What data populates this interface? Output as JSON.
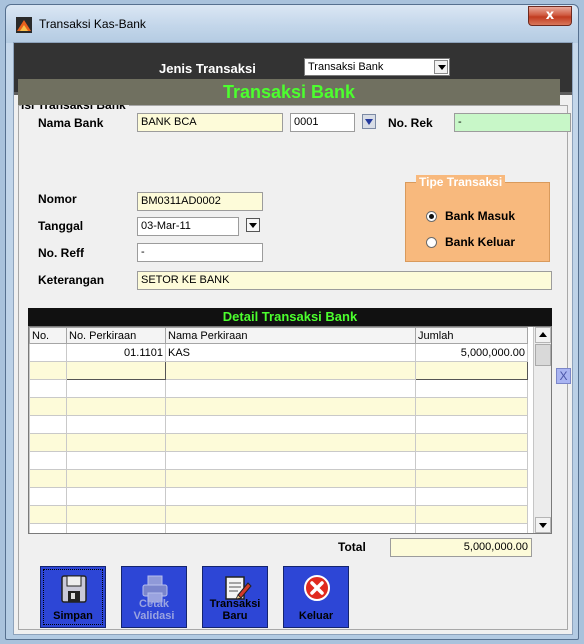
{
  "window": {
    "title": "Transaksi Kas-Bank",
    "close_glyph": "x"
  },
  "jenis_transaksi": {
    "label": "Jenis Transaksi",
    "value": "Transaksi Bank"
  },
  "isi": {
    "group_title": "Isi Transaksi Bank",
    "header": "Transaksi Bank",
    "nama_bank_label": "Nama Bank",
    "nama_bank_value": "BANK BCA",
    "kode_bank_value": "0001",
    "no_rek_label": "No. Rek",
    "no_rek_value": "-",
    "nomor_label": "Nomor",
    "nomor_value": "BM0311AD0002",
    "tanggal_label": "Tanggal",
    "tanggal_value": "03-Mar-11",
    "no_reff_label": "No. Reff",
    "no_reff_value": "-",
    "keterangan_label": "Keterangan",
    "keterangan_value": "SETOR KE BANK"
  },
  "tipe": {
    "title": "Tipe Transaksi",
    "options": [
      {
        "label": "Bank Masuk",
        "checked": true
      },
      {
        "label": "Bank Keluar",
        "checked": false
      }
    ]
  },
  "detail": {
    "header": "Detail Transaksi Bank",
    "columns": [
      "No.",
      "No. Perkiraan",
      "Nama Perkiraan",
      "Jumlah"
    ],
    "rows": [
      {
        "no": "",
        "no_perkiraan": "01.1101",
        "nama_perkiraan": "KAS",
        "jumlah": "5,000,000.00"
      }
    ],
    "delete_glyph": "X"
  },
  "total": {
    "label": "Total",
    "value": "5,000,000.00"
  },
  "buttons": {
    "simpan": "Simpan",
    "cetak_1": "Cetak",
    "cetak_2": "Validasi",
    "transaksi_1": "Transaksi",
    "transaksi_2": "Baru",
    "keluar": "Keluar"
  },
  "colors": {
    "accent_green": "#4cff2e",
    "header_bg": "#707060",
    "button_blue": "#2d46d6",
    "tipe_orange": "#f8b97d",
    "field_yellow": "#fdfbd9"
  },
  "icons": [
    "app-icon",
    "close-icon",
    "floppy-disk-icon",
    "printer-icon",
    "new-document-icon",
    "exit-x-icon"
  ]
}
